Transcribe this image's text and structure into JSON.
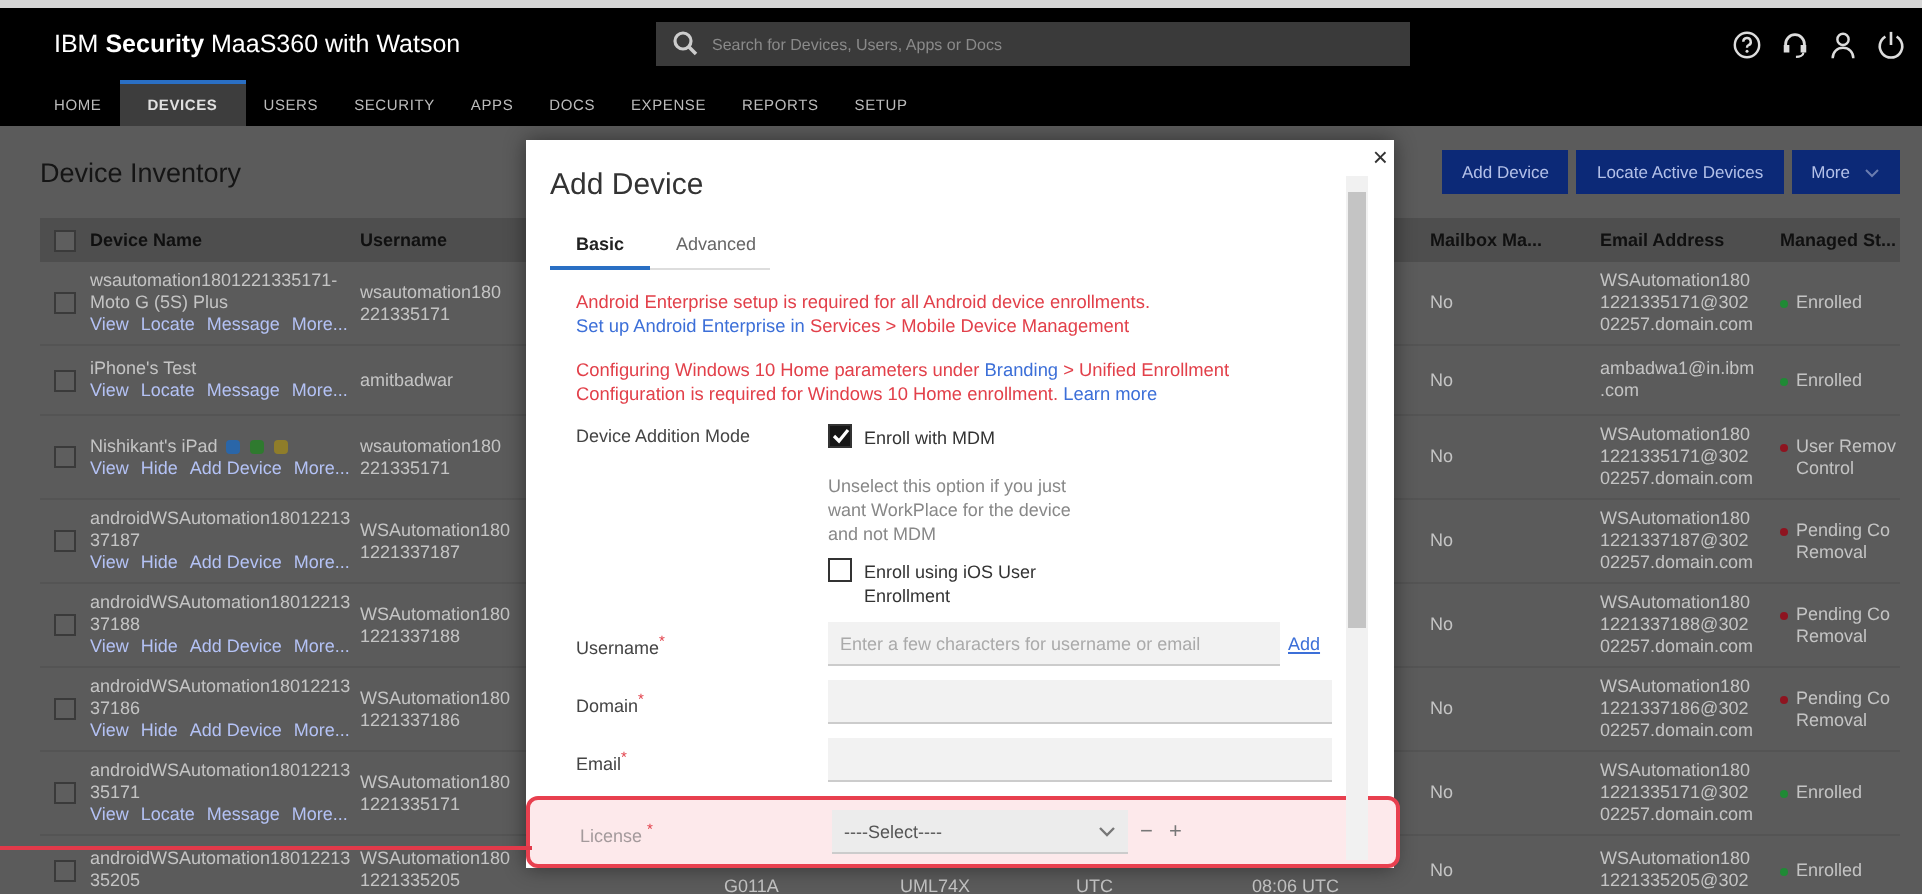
{
  "header": {
    "title": "IBM **Security** MaaS360 with Watson",
    "search": {
      "placeholder": "Search for Devices, Users, Apps or Docs"
    },
    "nav_tabs": [
      {
        "label": "HOME",
        "selected": false
      },
      {
        "label": "DEVICES",
        "selected": true
      },
      {
        "label": "USERS",
        "selected": false
      },
      {
        "label": "SECURITY",
        "selected": false
      },
      {
        "label": "APPS",
        "selected": false
      },
      {
        "label": "DOCS",
        "selected": false
      },
      {
        "label": "EXPENSE",
        "selected": false
      },
      {
        "label": "REPORTS",
        "selected": false
      },
      {
        "label": "SETUP",
        "selected": false
      }
    ]
  },
  "inventory": {
    "title": "Device Inventory",
    "buttons": [
      {
        "label": "Add Device",
        "kind": "plain"
      },
      {
        "label": "Locate Active Devices",
        "kind": "plain"
      },
      {
        "label": "More",
        "kind": "menu"
      }
    ],
    "select_all": {
      "checked": false
    },
    "columns": [
      {
        "label": "Device Name"
      },
      {
        "label": "Username"
      },
      {
        "label": "Mailbox Ma..."
      },
      {
        "label": "Email Address"
      },
      {
        "label": "Managed St..."
      }
    ],
    "rows": [
      {
        "checked": false,
        "name": "wsautomation1801221335171-\nMoto G (5S) Plus",
        "links": [
          "View",
          "Locate",
          "Message",
          "More..."
        ],
        "username": "wsautomation180\n221335171",
        "mailbox": "No",
        "email": "WSAutomation180\n1221335171@302\n02257.domain.com",
        "status": "Enrolled",
        "color": "#1f8a35"
      },
      {
        "checked": false,
        "name": "iPhone's Test",
        "links": [
          "View",
          "Locate",
          "Message",
          "More..."
        ],
        "username": "amitbadwar",
        "mailbox": "No",
        "email": "ambadwa1@in.ibm\n.com",
        "status": "Enrolled",
        "color": "#1f8a35"
      },
      {
        "checked": false,
        "name": "Nishikant's iPad",
        "device_icons": [
          {
            "color": "#2a66a8"
          },
          {
            "color": "#2f7a2f"
          },
          {
            "color": "#8f7d2a"
          }
        ],
        "links": [
          "View",
          "Hide",
          "Add Device",
          "More..."
        ],
        "username": "wsautomation180\n221335171",
        "mailbox": "No",
        "email": "WSAutomation180\n1221335171@302\n02257.domain.com",
        "status": "User Remov\nControl",
        "color": "#8e1420"
      },
      {
        "checked": false,
        "name": "androidWSAutomation18012213\n37187",
        "links": [
          "View",
          "Hide",
          "Add Device",
          "More..."
        ],
        "username": "WSAutomation180\n1221337187",
        "mailbox": "No",
        "email": "WSAutomation180\n1221337187@302\n02257.domain.com",
        "status": "Pending Co\nRemoval",
        "color": "#8e1420"
      },
      {
        "checked": false,
        "name": "androidWSAutomation18012213\n37188",
        "links": [
          "View",
          "Hide",
          "Add Device",
          "More..."
        ],
        "username": "WSAutomation180\n1221337188",
        "mailbox": "No",
        "email": "WSAutomation180\n1221337188@302\n02257.domain.com",
        "status": "Pending Co\nRemoval",
        "color": "#8e1420"
      },
      {
        "checked": false,
        "name": "androidWSAutomation18012213\n37186",
        "links": [
          "View",
          "Hide",
          "Add Device",
          "More..."
        ],
        "username": "WSAutomation180\n1221337186",
        "mailbox": "No",
        "email": "WSAutomation180\n1221337186@302\n02257.domain.com",
        "status": "Pending Co\nRemoval",
        "color": "#8e1420"
      },
      {
        "checked": false,
        "name": "androidWSAutomation18012213\n35171",
        "links": [
          "View",
          "Locate",
          "Message",
          "More..."
        ],
        "username": "WSAutomation180\n1221335171",
        "mailbox": "No",
        "email": "WSAutomation180\n1221335171@302\n02257.domain.com",
        "status": "Enrolled",
        "color": "#1f8a35"
      },
      {
        "checked": false,
        "name": "androidWSAutomation18012213\n35205",
        "links": [],
        "username": "WSAutomation180\n1221335205",
        "mid_cells": [
          "G011A",
          "UML74X",
          "UTC",
          "08:06 UTC"
        ],
        "mailbox": "No",
        "email": "WSAutomation180\n1221335205@302",
        "status": "Enrolled",
        "color": "#1f8a35"
      }
    ]
  },
  "dialog": {
    "title": "Add Device",
    "close": "×",
    "tabs": [
      {
        "label": "Basic",
        "selected": true
      },
      {
        "label": "Advanced",
        "selected": false
      }
    ],
    "notices": [
      {
        "parts": [
          {
            "kind": "text",
            "text": "Android Enterprise setup is required for all Android device enrollments. "
          },
          {
            "kind": "link",
            "text": "Set up Android Enterprise in"
          },
          {
            "kind": "text",
            "text": " Services > Mobile Device Management"
          }
        ]
      },
      {
        "parts": [
          {
            "kind": "text",
            "text": "Configuring Windows 10 Home parameters under "
          },
          {
            "kind": "link",
            "text": "Branding"
          },
          {
            "kind": "text",
            "text": " > Unified Enrollment Configuration is required for Windows 10 Home enrollment. "
          },
          {
            "kind": "link",
            "text": "Learn more"
          }
        ]
      }
    ],
    "fields": [
      {
        "kind": "mode",
        "label": "Device Addition Mode",
        "items": [
          {
            "kind": "checkbox",
            "label": "Enroll with MDM",
            "checked": true
          },
          {
            "kind": "help",
            "text": "Unselect this option if you just want WorkPlace for the device and not MDM"
          },
          {
            "kind": "checkbox",
            "label": "Enroll using iOS User Enrollment",
            "checked": false
          }
        ]
      },
      {
        "kind": "text",
        "label": "Username$^{*}$",
        "placeholder": "Enter a few characters for username or email",
        "link": "Add"
      },
      {
        "kind": "text",
        "label": "Domain$^{*}$"
      },
      {
        "kind": "text",
        "label": "Email$^{*}$"
      },
      {
        "kind": "select",
        "label": "License $^{*}$",
        "value": "----Select----",
        "actions": [
          "−",
          "+"
        ],
        "highlighted": true
      }
    ]
  }
}
